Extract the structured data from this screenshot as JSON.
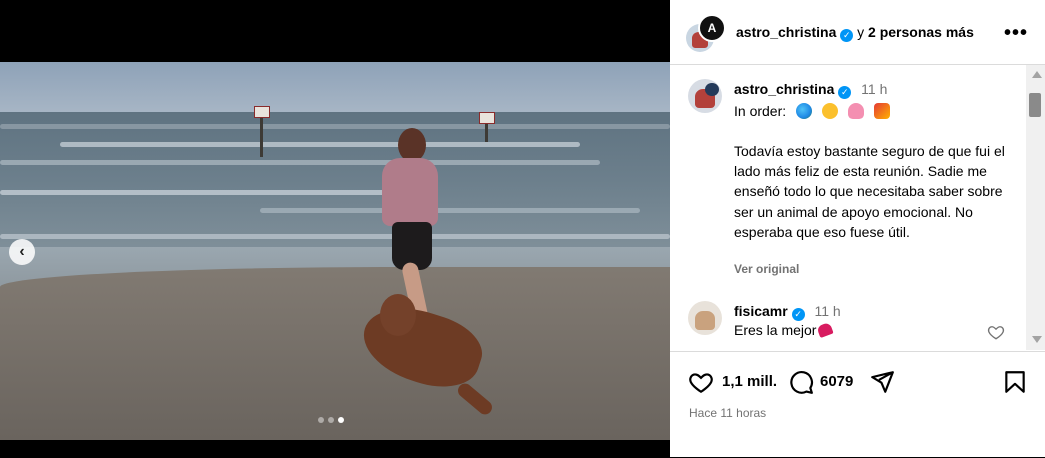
{
  "header": {
    "username": "astro_christina",
    "verified_mark": "✓",
    "collab_text": " y ",
    "collab_others": "2 personas más",
    "more_label": "•••",
    "avatar_glyph": "A"
  },
  "caption": {
    "username": "astro_christina",
    "time": "11 h",
    "first_line": "In order:",
    "emojis": [
      "globe-emoji",
      "hugging-face-emoji",
      "octopus-emoji",
      "rocket-emoji"
    ],
    "body": "Todavía estoy bastante seguro de que fui el lado más feliz de esta reunión. Sadie me enseñó todo lo que necesitaba saber sobre ser un animal de apoyo emocional. No esperaba que eso fuese útil.",
    "see_original": "Ver original"
  },
  "comment": {
    "username": "fisicamr",
    "time": "11 h",
    "text": "Eres la mejor"
  },
  "actions": {
    "likes": "1,1 mill.",
    "comments": "6079",
    "time_ago": "Hace 11 horas"
  },
  "carousel": {
    "total": 3,
    "active_index": 3
  },
  "colors": {
    "verified": "#0095f6",
    "secondary_text": "#737373",
    "border": "#dbdbdb"
  }
}
